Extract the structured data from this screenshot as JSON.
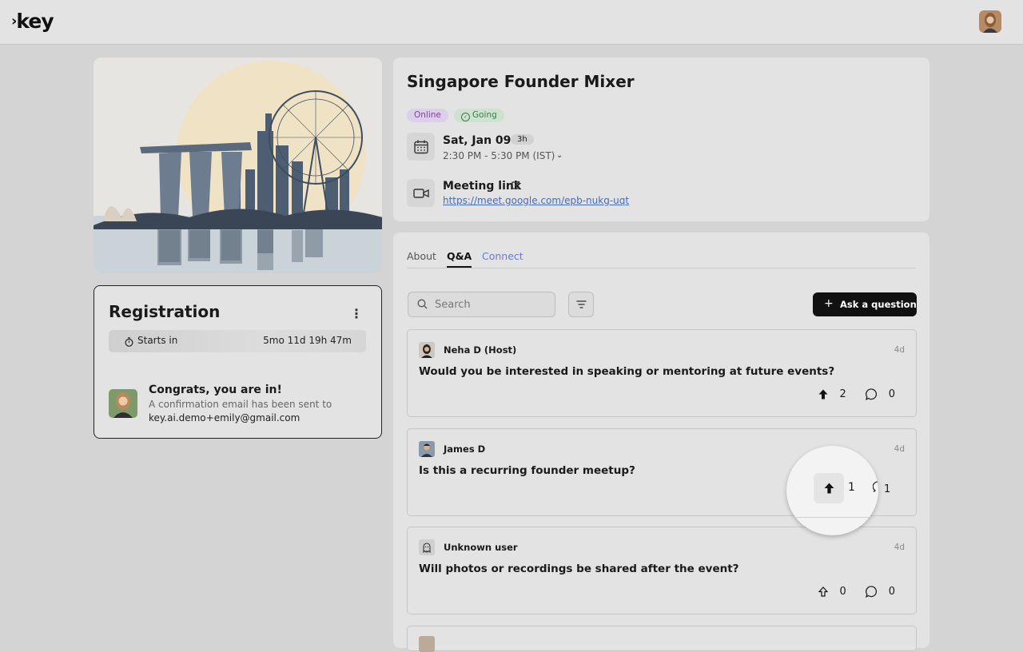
{
  "brand": {
    "logo_text": "key"
  },
  "event": {
    "title": "Singapore Founder Mixer",
    "badges": {
      "online": "Online",
      "going": "Going"
    },
    "date": "Sat, Jan 09",
    "duration": "3h",
    "time_range": "2:30 PM - 5:30 PM (IST)",
    "meeting_label": "Meeting link",
    "meeting_url": "https://meet.google.com/epb-nukg-uqt"
  },
  "registration": {
    "title": "Registration",
    "starts_label": "Starts in",
    "countdown": "5mo 11d 19h 47m",
    "congrats_title": "Congrats, you are in!",
    "congrats_sub": "A confirmation email has been sent to",
    "email": "key.ai.demo+emily@gmail.com"
  },
  "tabs": {
    "about": "About",
    "qa": "Q&A",
    "connect": "Connect"
  },
  "toolbar": {
    "search_placeholder": "Search",
    "ask_label": "Ask a question"
  },
  "questions": [
    {
      "author": "Neha D (Host)",
      "age": "4d",
      "text": "Would you be interested in speaking or mentoring at future events?",
      "upvotes": "2",
      "comments": "0"
    },
    {
      "author": "James D",
      "age": "4d",
      "text": "Is this a recurring founder meetup?",
      "upvotes": "1",
      "comments": "1"
    },
    {
      "author": "Unknown user",
      "age": "4d",
      "text": "Will photos or recordings be shared after the event?",
      "upvotes": "0",
      "comments": "0"
    }
  ],
  "colors": {
    "accent_black": "#111111",
    "online_purple": "#7b3fa8",
    "going_green": "#3d7a47",
    "link_blue": "#4a6cb0",
    "connect_tab": "#6a78d6"
  }
}
